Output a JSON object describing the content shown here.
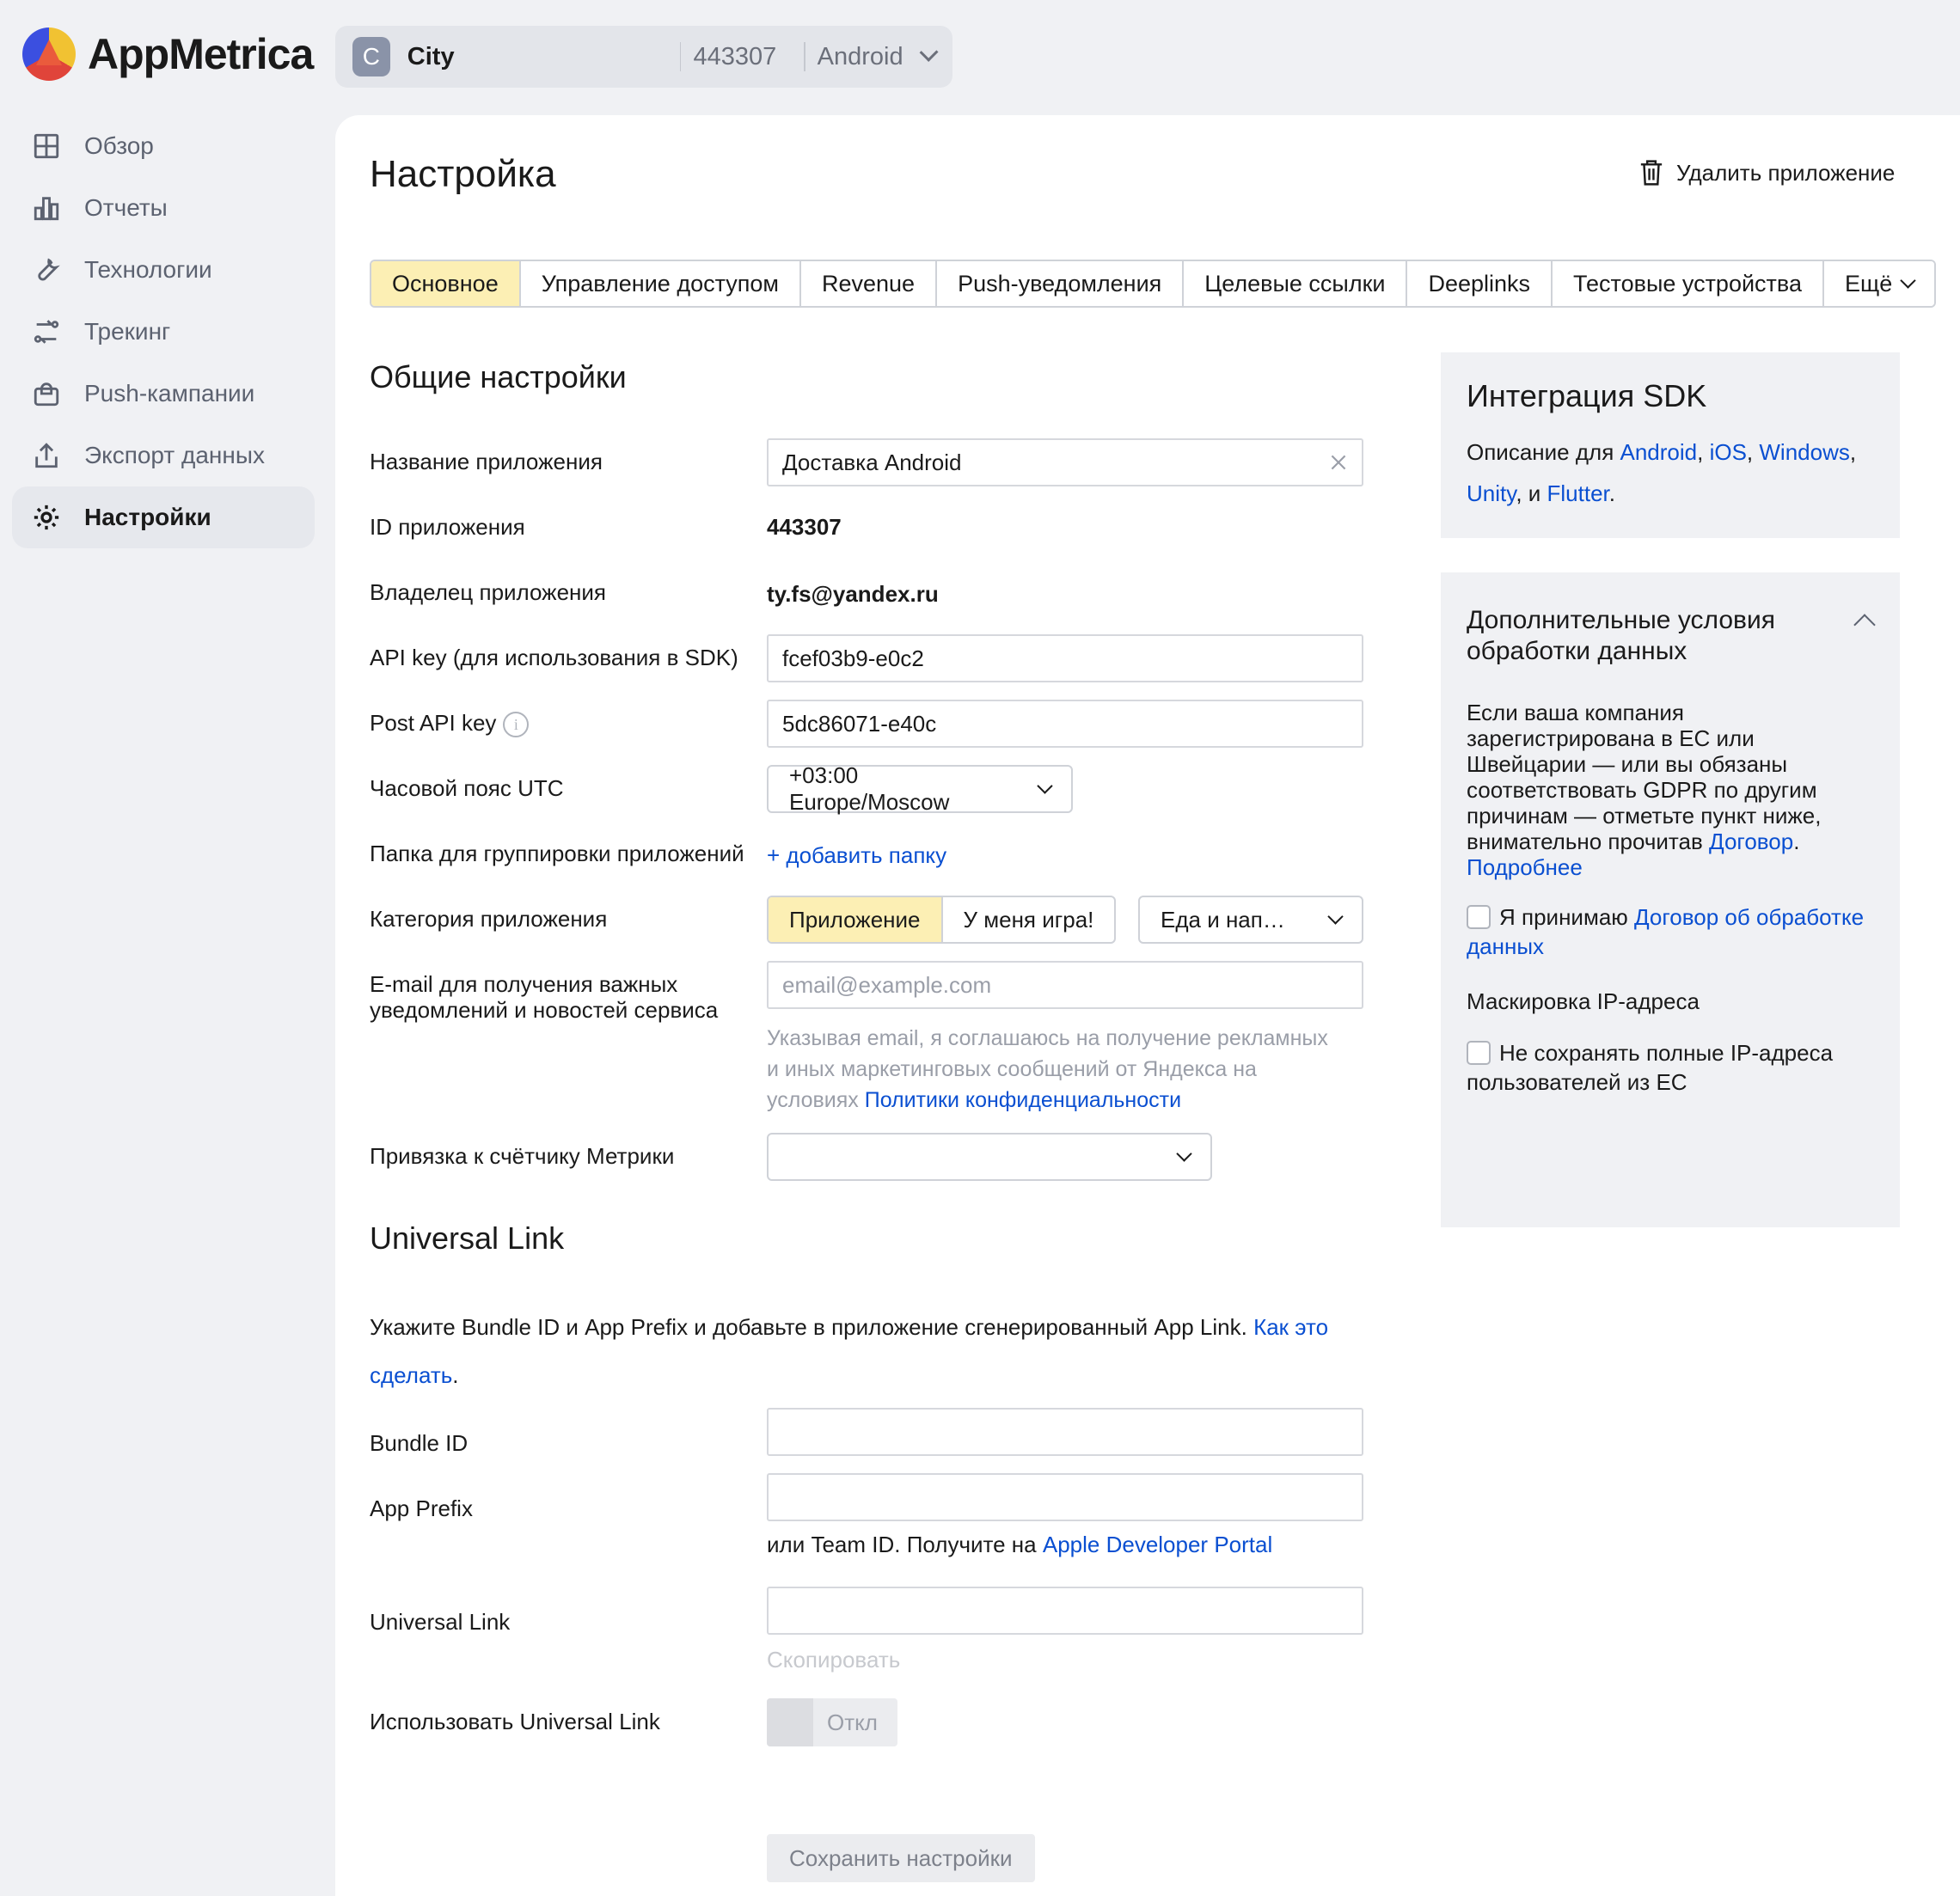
{
  "brand": {
    "name": "AppMetrica"
  },
  "app_switcher": {
    "avatar_letter": "C",
    "name": "City",
    "id": "443307",
    "platform": "Android"
  },
  "sidebar": {
    "items": [
      {
        "label": "Обзор",
        "icon": "grid-icon"
      },
      {
        "label": "Отчеты",
        "icon": "bar-chart-icon"
      },
      {
        "label": "Технологии",
        "icon": "wrench-icon"
      },
      {
        "label": "Трекинг",
        "icon": "tracking-icon"
      },
      {
        "label": "Push-кампании",
        "icon": "bell-icon"
      },
      {
        "label": "Экспорт данных",
        "icon": "export-icon"
      },
      {
        "label": "Настройки",
        "icon": "gear-icon",
        "active": true
      }
    ]
  },
  "page": {
    "title": "Настройка",
    "delete_label": "Удалить приложение"
  },
  "tabs": [
    "Основное",
    "Управление доступом",
    "Revenue",
    "Push-уведомления",
    "Целевые ссылки",
    "Deeplinks",
    "Тестовые устройства",
    "Ещё"
  ],
  "general": {
    "heading": "Общие настройки",
    "app_name_label": "Название приложения",
    "app_name_value": "Доставка Android",
    "app_id_label": "ID приложения",
    "app_id_value": "443307",
    "owner_label": "Владелец приложения",
    "owner_value": "ty.fs@yandex.ru",
    "api_key_label": "API key (для использования в SDK)",
    "api_key_value": "fcef03b9-e0c2",
    "post_api_key_label": "Post API key",
    "post_api_key_value": "5dc86071-e40c",
    "timezone_label": "Часовой пояс UTC",
    "timezone_value": "+03:00 Europe/Moscow",
    "folder_label": "Папка для группировки приложений",
    "folder_link": "+ добавить папку",
    "category_label": "Категория приложения",
    "category_options": [
      "Приложение",
      "У меня игра!"
    ],
    "category_select": "Еда и нап…",
    "email_label_1": "E-mail для получения важных",
    "email_label_2": "уведомлений и новостей сервиса",
    "email_placeholder": "email@example.com",
    "email_hint_1": "Указывая email, я соглашаюсь на получение рекламных",
    "email_hint_2": "и иных маркетинговых сообщений от Яндекса на",
    "email_hint_3": "условиях ",
    "email_hint_link": "Политики конфиденциальности",
    "metrika_label": "Привязка к счётчику Метрики",
    "metrika_value": ""
  },
  "universal": {
    "heading": "Universal Link",
    "desc": "Укажите Bundle ID и App Prefix и добавьте в приложение сгенерированный App Link. ",
    "desc_link_1": "Как это",
    "desc_link_2": "сделать",
    "desc_end": ".",
    "bundle_label": "Bundle ID",
    "bundle_value": "",
    "prefix_label": "App Prefix",
    "prefix_value": "",
    "team_hint": "или Team ID. Получите на ",
    "team_link": "Apple Developer Portal",
    "link_label": "Universal Link",
    "link_value": "",
    "copy_label": "Скопировать",
    "use_label": "Использовать Universal Link",
    "toggle_state": "Откл",
    "save_label": "Сохранить настройки"
  },
  "sdk_panel": {
    "title": "Интеграция SDK",
    "text": "Описание для ",
    "links": [
      "Android",
      "iOS",
      "Windows",
      "Unity",
      "Flutter"
    ],
    "and": ", и ",
    "comma": ", ",
    "dot": "."
  },
  "gdpr_panel": {
    "title_1": "Дополнительные условия",
    "title_2": "обработки данных",
    "text_lines": [
      "Если ваша компания",
      "зарегистрирована в ЕС или",
      "Швейцарии — или вы обязаны",
      "соответствовать GDPR по другим",
      "причинам — отметьте пункт ниже,",
      "внимательно прочитав "
    ],
    "contract_link": "Договор",
    "more_link": "Подробнее",
    "accept_text": "Я принимаю ",
    "accept_link_1": "Договор об обработке",
    "accept_link_2": "данных",
    "mask_title": "Маскировка IP-адреса",
    "mask_text_1": "Не сохранять полные IP-адреса",
    "mask_text_2": "пользователей из ЕС"
  }
}
